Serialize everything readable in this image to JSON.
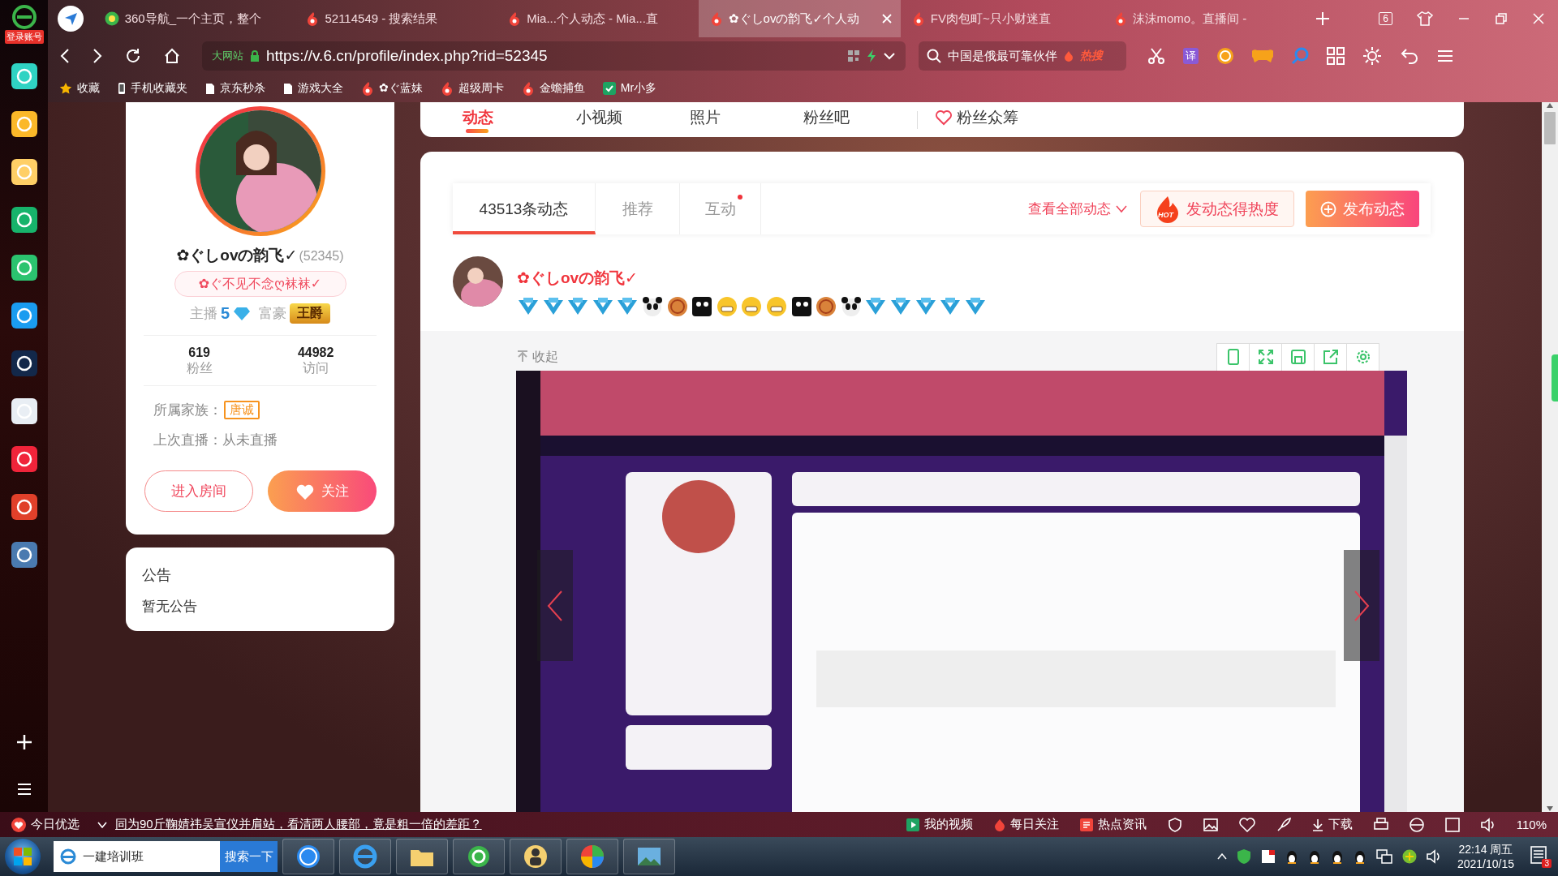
{
  "browser": {
    "login": "登录账号",
    "tabs": [
      {
        "label": "360导航_一个主页，整个",
        "kind": "nav",
        "selected": false
      },
      {
        "label": "52114549 - 搜索结果",
        "kind": "six",
        "selected": false
      },
      {
        "label": "Mia...个人动态 - Mia...直",
        "kind": "six",
        "selected": false
      },
      {
        "label": "✿ぐしovの韵飞✓个人动",
        "kind": "six",
        "selected": true
      },
      {
        "label": "FV肉包町~只小财迷直",
        "kind": "six",
        "selected": false
      },
      {
        "label": "沫沫momo。直播间 -",
        "kind": "six",
        "selected": false
      }
    ],
    "tab_count": "6",
    "address": {
      "security": "大网站",
      "url": "https://v.6.cn/profile/index.php?rid=52345"
    },
    "search": {
      "value": "中国是俄最可靠伙伴",
      "tag": "热搜"
    },
    "translate": "译",
    "bookmarks": [
      {
        "label": "收藏",
        "kind": "star"
      },
      {
        "label": "手机收藏夹",
        "kind": "phone"
      },
      {
        "label": "京东秒杀",
        "kind": "page"
      },
      {
        "label": "游戏大全",
        "kind": "page"
      },
      {
        "label": "✿ぐ蓝妹",
        "kind": "six"
      },
      {
        "label": "超级周卡",
        "kind": "six"
      },
      {
        "label": "金蟾捕鱼",
        "kind": "six"
      },
      {
        "label": "Mr小多",
        "kind": "app"
      }
    ]
  },
  "profile_nav": [
    {
      "label": "动态",
      "selected": true,
      "kind": "plain"
    },
    {
      "label": "小视频",
      "selected": false,
      "kind": "plain"
    },
    {
      "label": "照片",
      "selected": false,
      "kind": "plain"
    },
    {
      "label": "粉丝吧",
      "selected": false,
      "kind": "plain"
    },
    {
      "label": "粉丝众筹",
      "selected": false,
      "kind": "crowdfund"
    }
  ],
  "profile": {
    "name": "✿ぐしovの韵飞✓",
    "id": "(52345)",
    "signature": "✿ぐ不见不念ღ袜袜✓",
    "anchor_label": "主播",
    "anchor_level": "5",
    "rich_label": "富豪",
    "rich_rank": "王爵",
    "stats": [
      {
        "value": "619",
        "label": "粉丝"
      },
      {
        "value": "44982",
        "label": "访问"
      }
    ],
    "family_label": "所属家族：",
    "family": "唐诚",
    "last_live": "上次直播：从未直播",
    "buttons": [
      {
        "label": "进入房间",
        "kind": "outline"
      },
      {
        "label": "关注",
        "kind": "follow"
      }
    ]
  },
  "notice": {
    "title": "公告",
    "body": "暂无公告"
  },
  "feed": {
    "tabs": [
      {
        "label": "43513条动态",
        "selected": true,
        "dot": false
      },
      {
        "label": "推荐",
        "selected": false,
        "dot": false
      },
      {
        "label": "互动",
        "selected": false,
        "dot": true
      }
    ],
    "view_all": "查看全部动态",
    "hot_badge": "HOT",
    "hot_button": "发动态得热度",
    "post_button": "发布动态",
    "post": {
      "author": "✿ぐしovの韵飞✓",
      "emoticons": [
        {
          "kind": "level"
        },
        {
          "kind": "level"
        },
        {
          "kind": "level"
        },
        {
          "kind": "level"
        },
        {
          "kind": "level"
        },
        {
          "kind": "panda"
        },
        {
          "kind": "medal"
        },
        {
          "kind": "dark"
        },
        {
          "kind": "grin"
        },
        {
          "kind": "grin"
        },
        {
          "kind": "grin"
        },
        {
          "kind": "dark"
        },
        {
          "kind": "medal"
        },
        {
          "kind": "panda"
        },
        {
          "kind": "level"
        },
        {
          "kind": "level"
        },
        {
          "kind": "level"
        },
        {
          "kind": "level"
        },
        {
          "kind": "level"
        }
      ],
      "collapse": "收起"
    }
  },
  "status_bar": {
    "promo": "今日优选",
    "headline": "同为90斤鞠婧祎吴宣仪并肩站，看清两人腰部，竟是粗一倍的差距？",
    "links": [
      {
        "label": "我的视频",
        "kind": "video"
      },
      {
        "label": "每日关注",
        "kind": "flame"
      },
      {
        "label": "热点资讯",
        "kind": "news"
      }
    ],
    "download": "下载",
    "zoom": "110%"
  },
  "taskbar": {
    "search_value": "一建培训班",
    "search_button": "搜索一下",
    "time": "22:14 周五",
    "date": "2021/10/15",
    "notifications": "3"
  }
}
